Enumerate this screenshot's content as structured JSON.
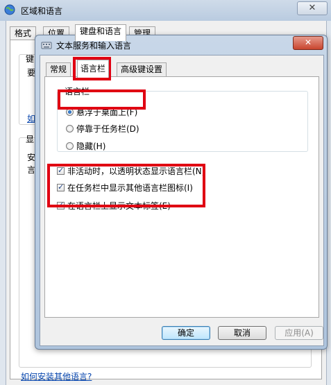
{
  "back_window": {
    "title": "区域和语言",
    "close_label": "✕",
    "tabs": [
      {
        "label": "格式"
      },
      {
        "label": "位置"
      },
      {
        "label": "键盘和语言"
      },
      {
        "label": "管理"
      }
    ],
    "fragments": {
      "keyboard_group": "键",
      "keyboard_text": "要",
      "link_fragment": "如",
      "display_group": "显",
      "display_text_1": "安",
      "display_text_2": "言"
    },
    "bottom_link": "如何安装其他语言?"
  },
  "dialog": {
    "title": "文本服务和输入语言",
    "close_label": "✕",
    "tabs": [
      {
        "label": "常规"
      },
      {
        "label": "语言栏"
      },
      {
        "label": "高级键设置"
      }
    ],
    "language_bar_group": {
      "legend": "语言栏",
      "options": [
        {
          "label": "悬浮于桌面上(F)",
          "checked": true
        },
        {
          "label": "停靠于任务栏(D)",
          "checked": false
        },
        {
          "label": "隐藏(H)",
          "checked": false
        }
      ]
    },
    "checkboxes": [
      {
        "label": "非活动时，以透明状态显示语言栏(N)",
        "checked": true
      },
      {
        "label": "在任务栏中显示其他语言栏图标(I)",
        "checked": true
      },
      {
        "label": "在语言栏上显示文本标签(E)",
        "checked": true
      }
    ],
    "buttons": {
      "ok": "确定",
      "cancel": "取消",
      "apply": "应用(A)"
    }
  },
  "colors": {
    "highlight_box": "#e00012",
    "link": "#0645ad"
  }
}
